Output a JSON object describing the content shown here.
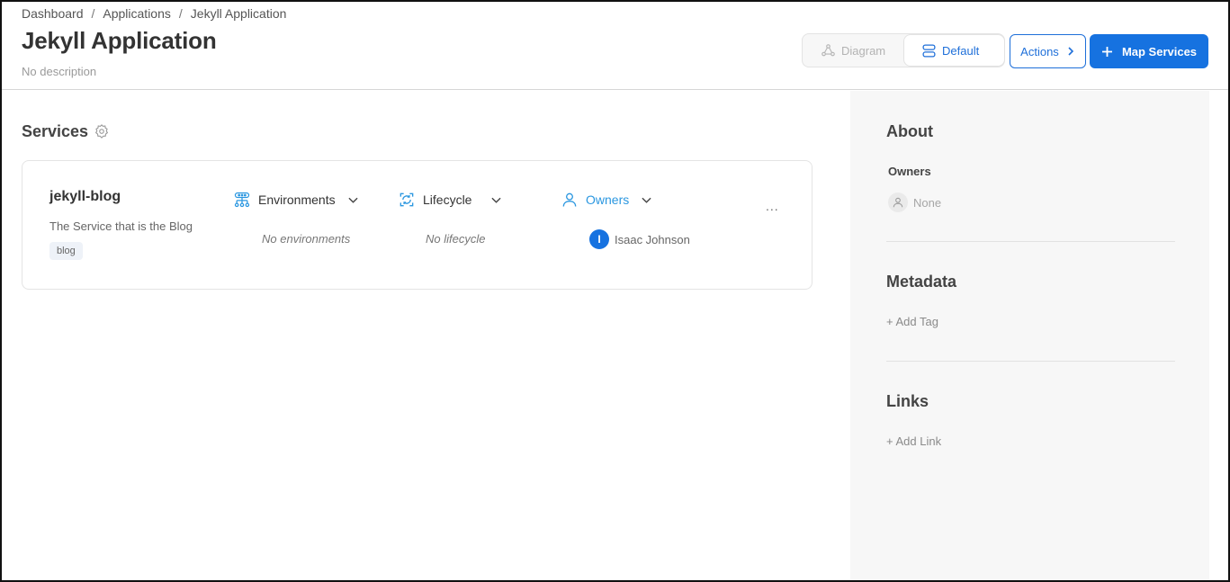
{
  "breadcrumb": {
    "items": [
      "Dashboard",
      "Applications",
      "Jekyll Application"
    ],
    "separator": "/"
  },
  "page": {
    "title": "Jekyll Application",
    "description": "No description"
  },
  "toolbar": {
    "diagram_label": "Diagram",
    "default_label": "Default",
    "actions_label": "Actions",
    "map_services_label": "Map Services"
  },
  "services": {
    "title": "Services",
    "card": {
      "name": "jekyll-blog",
      "description": "The Service that is the Blog",
      "tag": "blog",
      "environments_label": "Environments",
      "environments_empty": "No environments",
      "lifecycle_label": "Lifecycle",
      "lifecycle_empty": "No lifecycle",
      "owners_label": "Owners",
      "owner_initial": "I",
      "owner_name": "Isaac Johnson",
      "more": "..."
    }
  },
  "sidebar": {
    "about_title": "About",
    "owners_label": "Owners",
    "owners_value": "None",
    "metadata_title": "Metadata",
    "add_tag": "+ Add Tag",
    "links_title": "Links",
    "add_link": "+ Add Link"
  },
  "colors": {
    "primary": "#1672e0",
    "owners_accent": "#2b97e0",
    "sidebar_bg": "#f7f7f7"
  }
}
